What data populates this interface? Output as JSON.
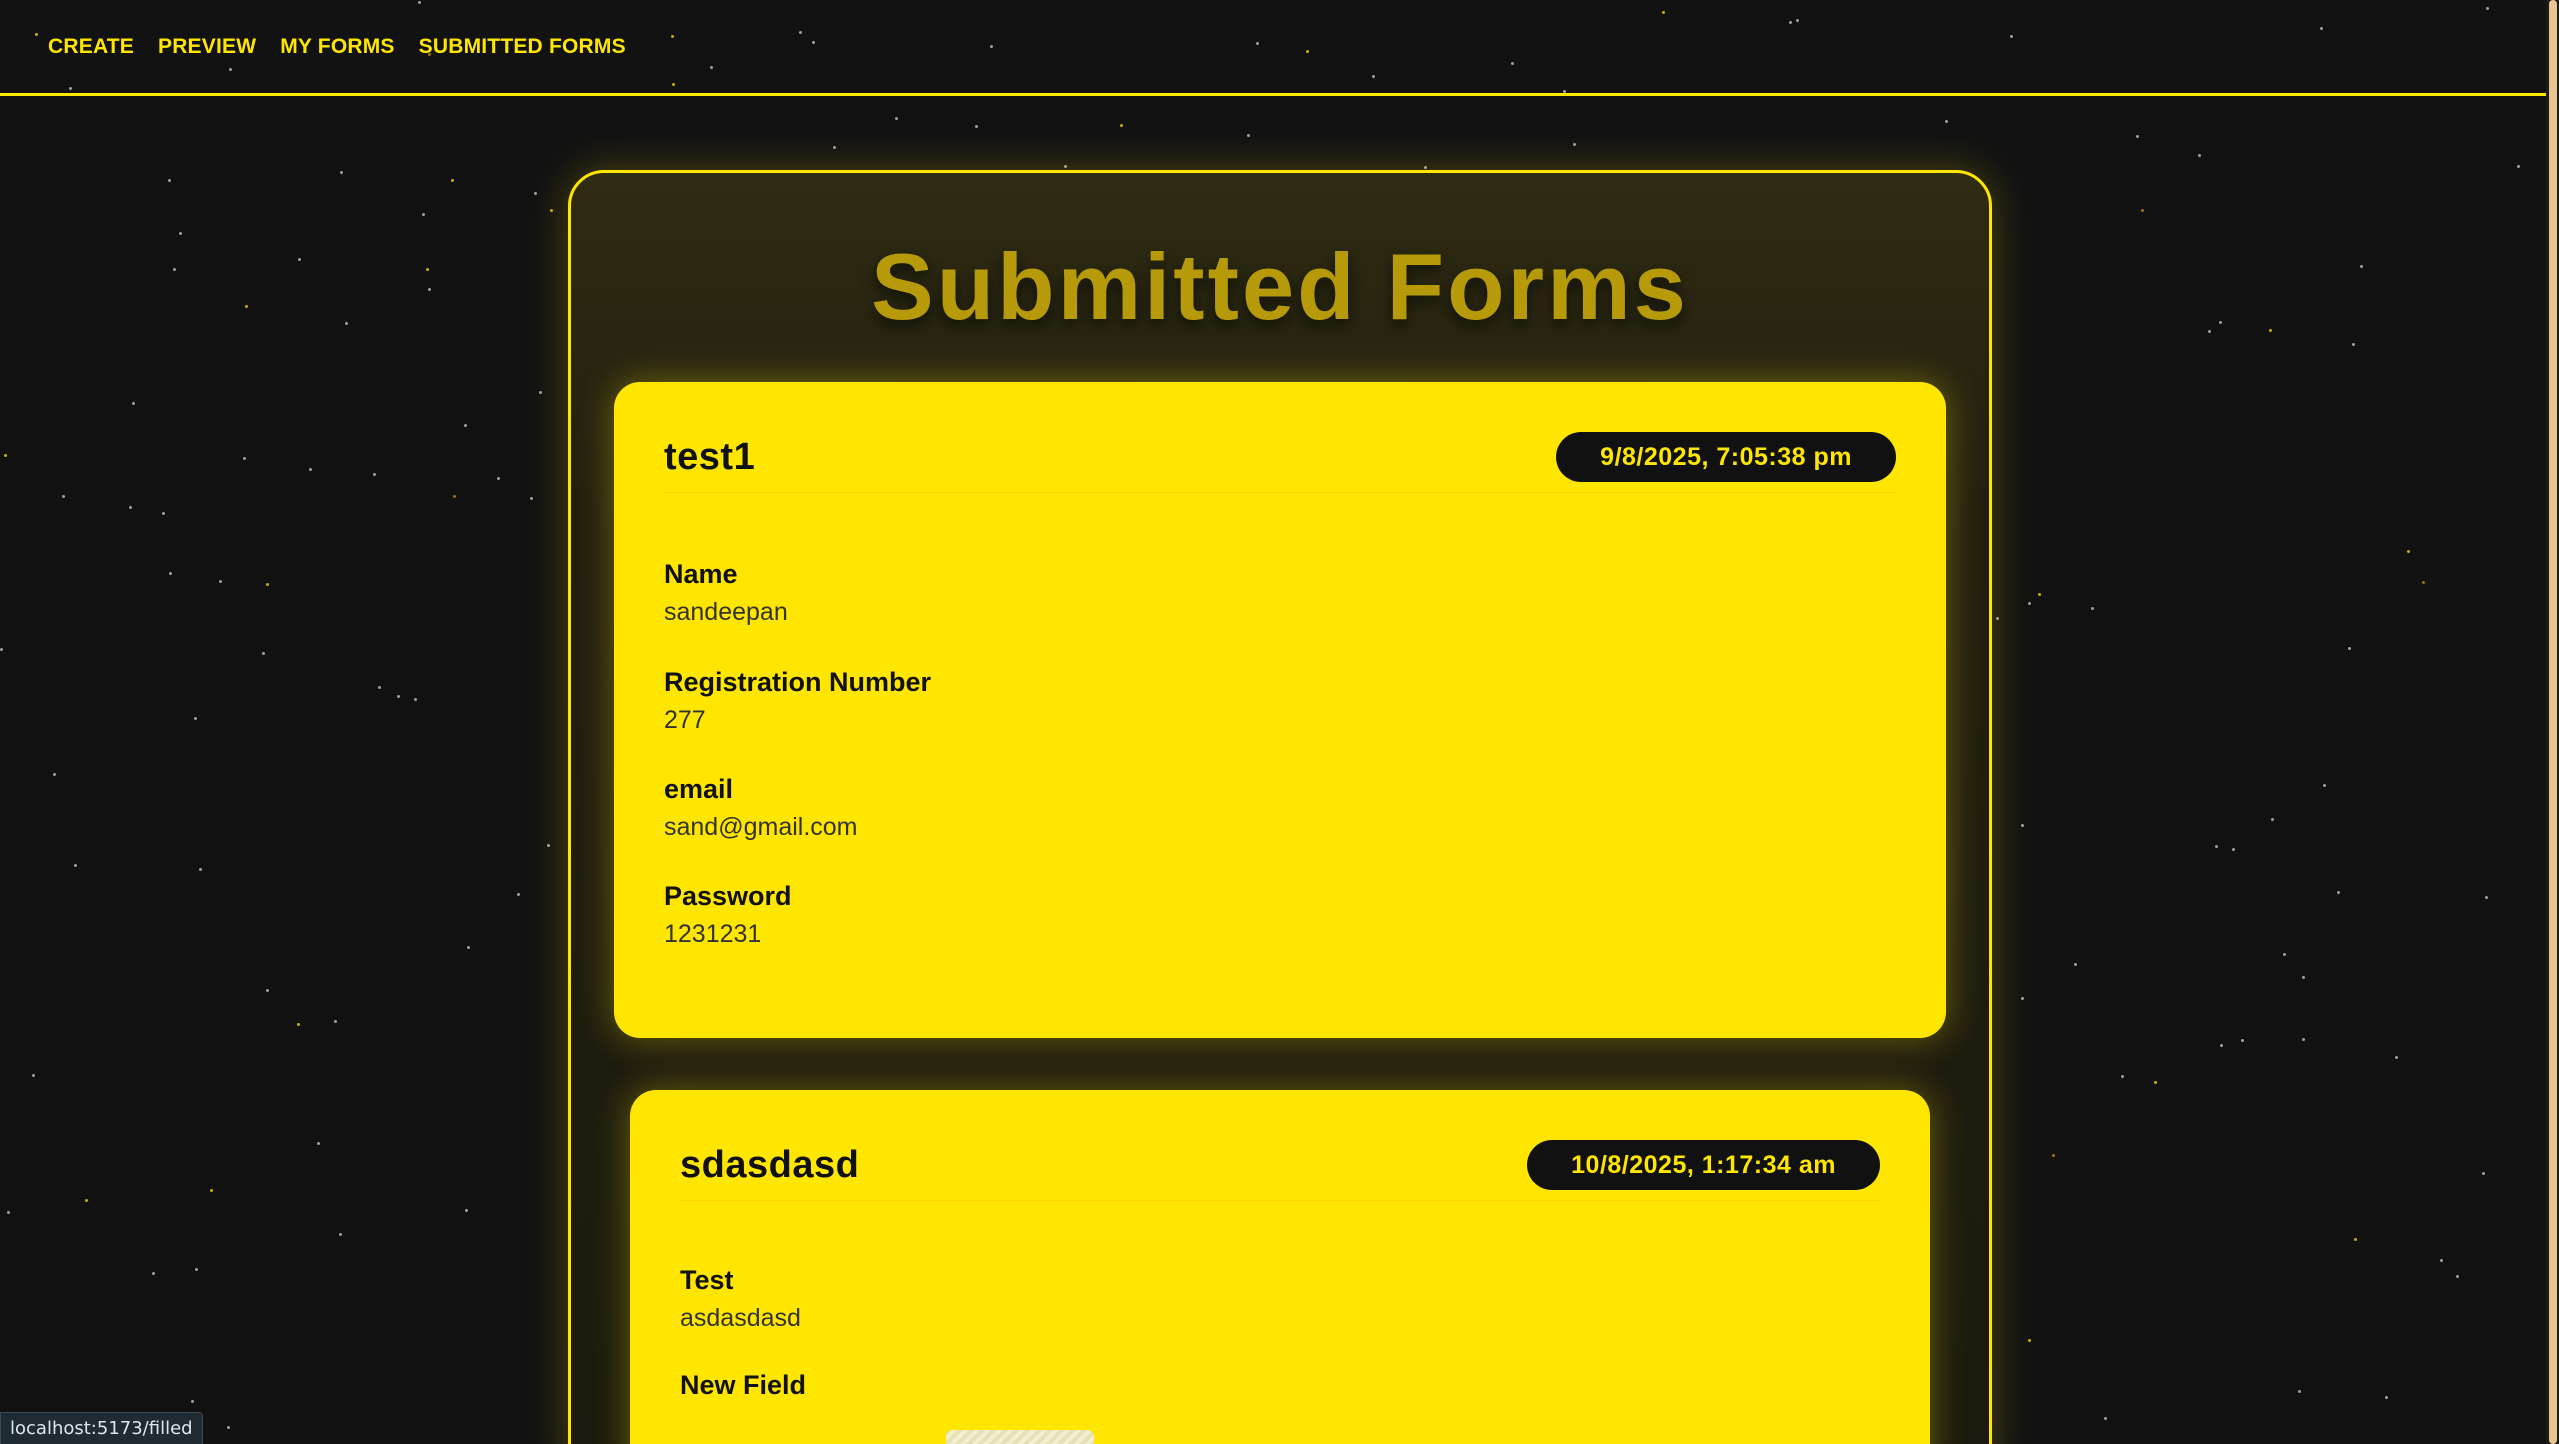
{
  "nav": {
    "items": [
      {
        "label": "CREATE"
      },
      {
        "label": "PREVIEW"
      },
      {
        "label": "MY FORMS"
      },
      {
        "label": "SUBMITTED FORMS"
      }
    ]
  },
  "page": {
    "title": "Submitted Forms"
  },
  "submissions": [
    {
      "title": "test1",
      "date": "9/8/2025, 7:05:38 pm",
      "fields": [
        {
          "label": "Name",
          "value": "sandeepan"
        },
        {
          "label": "Registration Number",
          "value": "277"
        },
        {
          "label": "email",
          "value": "sand@gmail.com"
        },
        {
          "label": "Password",
          "value": "1231231"
        }
      ]
    },
    {
      "title": "sdasdasd",
      "date": "10/8/2025, 1:17:34 am",
      "fields": [
        {
          "label": "Test",
          "value": "asdasdasd"
        },
        {
          "label": "New Field",
          "value": ""
        }
      ]
    }
  ],
  "status_bar": {
    "url": "localhost:5173/filled"
  },
  "colors": {
    "accent": "#ffe600",
    "background": "#121212",
    "title": "#b79a09"
  }
}
